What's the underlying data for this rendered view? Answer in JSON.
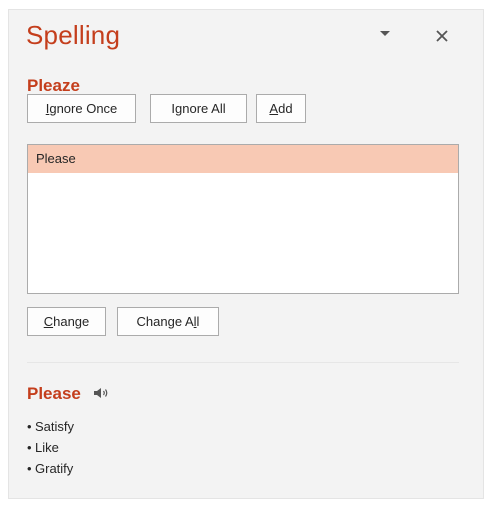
{
  "pane": {
    "title": "Spelling",
    "misspelled_word": "Pleaze",
    "buttons": {
      "ignore_once": {
        "mnemonic": "I",
        "rest": "gnore Once"
      },
      "ignore_all": {
        "pre": "I",
        "mnemonic": "g",
        "rest": "nore All"
      },
      "add": {
        "mnemonic": "A",
        "rest": "dd"
      }
    },
    "suggestions": [
      "Please"
    ],
    "selected_suggestion": "Please",
    "change_buttons": {
      "change": {
        "mnemonic": "C",
        "rest": "hange"
      },
      "change_all": {
        "pre": "Change A",
        "mnemonic": "l",
        "rest": "l"
      }
    },
    "definition": {
      "word": "Please",
      "synonyms": [
        "Satisfy",
        "Like",
        "Gratify"
      ]
    },
    "icons": {
      "menu": "chevron-down-icon",
      "close": "close-icon",
      "speaker": "speaker-icon"
    },
    "accent_color": "#c43e1c",
    "selection_color": "#f8c9b4"
  }
}
